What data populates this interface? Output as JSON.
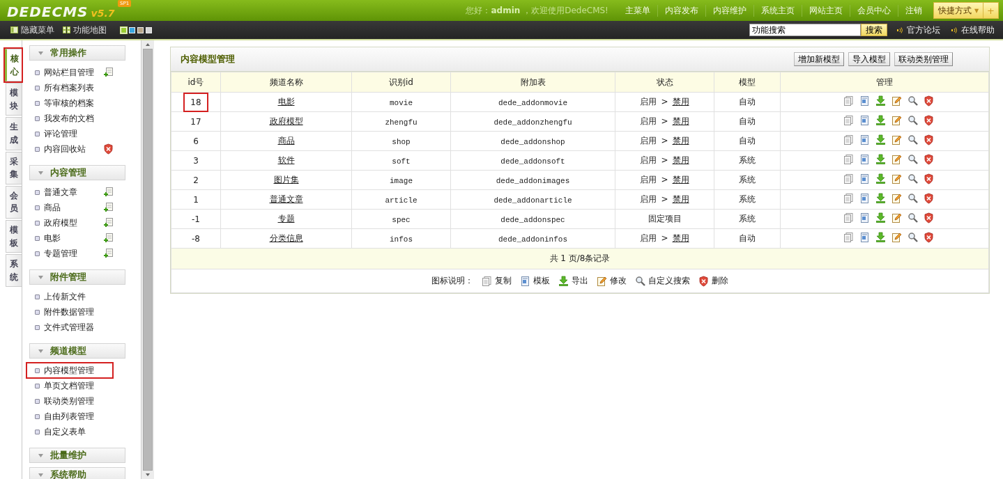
{
  "header": {
    "logo": "DEDECMS",
    "version": "v5.7",
    "badge": "SP1",
    "greeting": "您好：**admin** ，欢迎使用DedeCMS!",
    "nav": [
      "主菜单",
      "内容发布",
      "内容维护",
      "系统主页",
      "网站主页",
      "会员中心",
      "注销"
    ],
    "shortcut": "快捷方式",
    "shortcut_caret": "▼",
    "shortcut_add": "+"
  },
  "toolbar": {
    "buttons": [
      {
        "kind": "hide",
        "label": "隐藏菜单"
      },
      {
        "kind": "map",
        "label": "功能地图"
      }
    ],
    "skins": [
      {
        "color": "#9acd32",
        "selected": true
      },
      {
        "color": "#3aa6e0",
        "selected": false
      },
      {
        "color": "#b8a68a",
        "selected": false
      },
      {
        "color": "#d6d6d6",
        "selected": false
      }
    ],
    "search_value": "功能搜索",
    "search_button": "搜索",
    "links": [
      "官方论坛",
      "在线帮助"
    ]
  },
  "side_tabs": [
    {
      "label": "核心",
      "selected": true,
      "highlighted": true
    },
    {
      "label": "模块",
      "selected": false,
      "highlighted": false
    },
    {
      "label": "生成",
      "selected": false,
      "highlighted": false
    },
    {
      "label": "采集",
      "selected": false,
      "highlighted": false
    },
    {
      "label": "会员",
      "selected": false,
      "highlighted": false
    },
    {
      "label": "模板",
      "selected": false,
      "highlighted": false
    },
    {
      "label": "系统",
      "selected": false,
      "highlighted": false
    }
  ],
  "menu": [
    {
      "title": "常用操作",
      "items": [
        {
          "label": "网站栏目管理",
          "kind": "add",
          "highlighted": false
        },
        {
          "label": "所有档案列表",
          "kind": "plain",
          "highlighted": false
        },
        {
          "label": "等审核的档案",
          "kind": "plain",
          "highlighted": false
        },
        {
          "label": "我发布的文档",
          "kind": "plain",
          "highlighted": false
        },
        {
          "label": "评论管理",
          "kind": "plain",
          "highlighted": false
        },
        {
          "label": "内容回收站",
          "kind": "delete",
          "highlighted": false
        }
      ]
    },
    {
      "title": "内容管理",
      "items": [
        {
          "label": "普通文章",
          "kind": "add",
          "highlighted": false
        },
        {
          "label": "商品",
          "kind": "add",
          "highlighted": false
        },
        {
          "label": "政府模型",
          "kind": "add",
          "highlighted": false
        },
        {
          "label": "电影",
          "kind": "add",
          "highlighted": false
        },
        {
          "label": "专题管理",
          "kind": "add",
          "highlighted": false
        }
      ]
    },
    {
      "title": "附件管理",
      "items": [
        {
          "label": "上传新文件",
          "kind": "plain",
          "highlighted": false
        },
        {
          "label": "附件数据管理",
          "kind": "plain",
          "highlighted": false
        },
        {
          "label": "文件式管理器",
          "kind": "plain",
          "highlighted": false
        }
      ]
    },
    {
      "title": "频道模型",
      "items": [
        {
          "label": "内容模型管理",
          "kind": "plain",
          "highlighted": true
        },
        {
          "label": "单页文档管理",
          "kind": "plain",
          "highlighted": false
        },
        {
          "label": "联动类别管理",
          "kind": "plain",
          "highlighted": false
        },
        {
          "label": "自由列表管理",
          "kind": "plain",
          "highlighted": false
        },
        {
          "label": "自定义表单",
          "kind": "plain",
          "highlighted": false
        }
      ]
    },
    {
      "title": "批量维护"
    },
    {
      "title": "系统帮助"
    }
  ],
  "panel": {
    "title": "内容模型管理",
    "buttons": [
      "增加新模型",
      "导入模型",
      "联动类别管理"
    ],
    "columns": [
      "id号",
      "频道名称",
      "识别id",
      "附加表",
      "状态",
      "模型",
      "管理"
    ],
    "rows": [
      {
        "id": "18",
        "name": "电影",
        "ident": "movie",
        "table": "dede_addonmovie",
        "status": "启用",
        "status_sep": ">",
        "status_link": "禁用",
        "model": "自动",
        "highlighted": true
      },
      {
        "id": "17",
        "name": "政府模型",
        "ident": "zhengfu",
        "table": "dede_addonzhengfu",
        "status": "启用",
        "status_sep": ">",
        "status_link": "禁用",
        "model": "自动",
        "highlighted": false
      },
      {
        "id": "6",
        "name": "商品",
        "ident": "shop",
        "table": "dede_addonshop",
        "status": "启用",
        "status_sep": ">",
        "status_link": "禁用",
        "model": "自动",
        "highlighted": false
      },
      {
        "id": "3",
        "name": "软件",
        "ident": "soft",
        "table": "dede_addonsoft",
        "status": "启用",
        "status_sep": ">",
        "status_link": "禁用",
        "model": "系统",
        "highlighted": false
      },
      {
        "id": "2",
        "name": "图片集",
        "ident": "image",
        "table": "dede_addonimages",
        "status": "启用",
        "status_sep": ">",
        "status_link": "禁用",
        "model": "系统",
        "highlighted": false
      },
      {
        "id": "1",
        "name": "普通文章",
        "ident": "article",
        "table": "dede_addonarticle",
        "status": "启用",
        "status_sep": ">",
        "status_link": "禁用",
        "model": "系统",
        "highlighted": false
      },
      {
        "id": "-1",
        "name": "专题",
        "ident": "spec",
        "table": "dede_addonspec",
        "status": "固定项目",
        "model": "系统",
        "highlighted": false
      },
      {
        "id": "-8",
        "name": "分类信息",
        "ident": "infos",
        "table": "dede_addoninfos",
        "status": "启用",
        "status_sep": ">",
        "status_link": "禁用",
        "model": "自动",
        "highlighted": false
      }
    ],
    "pager": "共 1 页/8条记录",
    "legend_label": "图标说明：",
    "legend": [
      {
        "kind": "copy",
        "label": "复制"
      },
      {
        "kind": "template",
        "label": "模板"
      },
      {
        "kind": "export",
        "label": "导出"
      },
      {
        "kind": "edit",
        "label": "修改"
      },
      {
        "kind": "search",
        "label": "自定义搜索"
      },
      {
        "kind": "delete",
        "label": "删除"
      }
    ]
  }
}
